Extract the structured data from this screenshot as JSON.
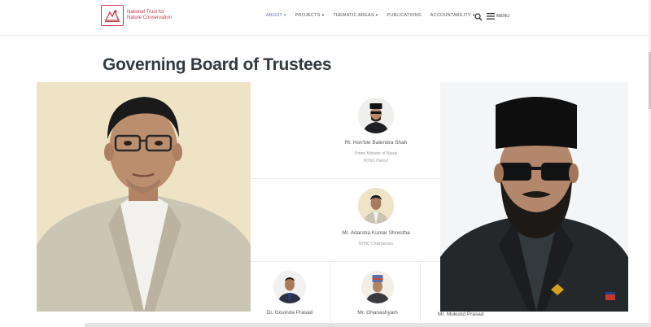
{
  "header": {
    "logo_line1": "National Trust for",
    "logo_line2": "Nature Conservation",
    "nav": [
      {
        "label": "ABOUT",
        "active": true,
        "dropdown": true
      },
      {
        "label": "PROJECTS",
        "active": false,
        "dropdown": true
      },
      {
        "label": "THEMATIC AREAS",
        "active": false,
        "dropdown": true
      },
      {
        "label": "PUBLICATIONS",
        "active": false,
        "dropdown": false
      },
      {
        "label": "ACCOUNTABILITY",
        "active": false,
        "dropdown": true
      }
    ],
    "menu_label": "MENU"
  },
  "page": {
    "title": "Governing Board of Trustees"
  },
  "trustees": [
    {
      "name": "Rt. Hon'ble Balendra Shah",
      "role_line1": "Prime Minister of Nepal",
      "role_line2": "NTNC Patron"
    },
    {
      "name": "Mr. Adarsha Kumar Shrestha",
      "role_line1": "NTNC Chairperson",
      "role_line2": ""
    },
    {
      "name": "Dr. Govinda Prasad",
      "role_line1": "",
      "role_line2": ""
    },
    {
      "name": "Mr. Ghanashyam",
      "role_line1": "",
      "role_line2": ""
    },
    {
      "name": "Mr. Mukund Prasad",
      "role_line1": "",
      "role_line2": ""
    }
  ],
  "colors": {
    "brand": "#c43a4a",
    "nav_active": "#6b6fb0",
    "title": "#333a40"
  }
}
